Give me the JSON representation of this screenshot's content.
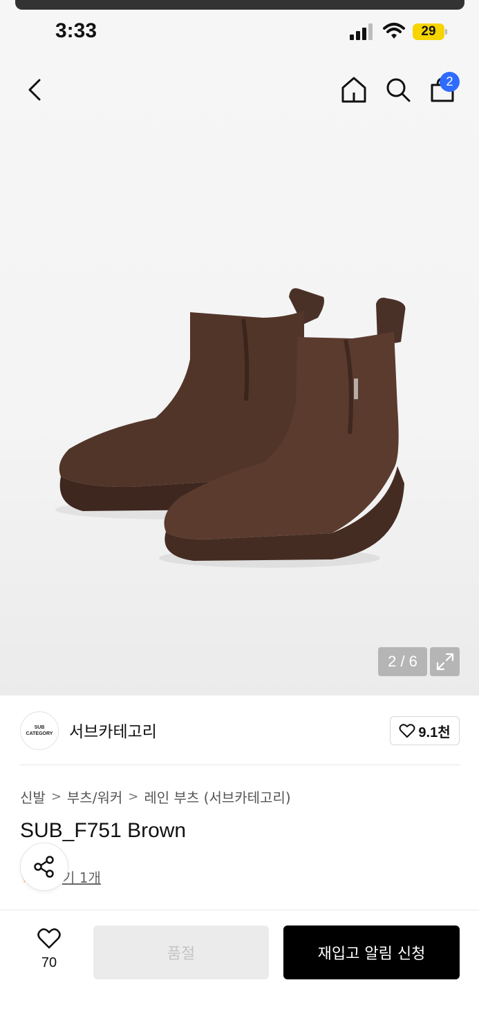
{
  "status_bar": {
    "time": "3:33",
    "battery": "29"
  },
  "header": {
    "back_icon": "chevron-left-icon",
    "home_icon": "home-icon",
    "search_icon": "search-icon",
    "bag_icon": "shopping-bag-icon",
    "bag_count": "2",
    "badge_color": "#2f6bff"
  },
  "gallery": {
    "counter": "2 / 6",
    "expand_icon": "expand-icon",
    "product_color": "#4a3128"
  },
  "brand": {
    "logo_line1": "SUB",
    "logo_line2": "CATEGORY",
    "name": "서브카테고리",
    "like_count": "9.1천"
  },
  "breadcrumb": {
    "items": [
      "신발",
      "부츠/워커",
      "레인 부츠 (서브카테고리)"
    ]
  },
  "product": {
    "title": "SUB_F751 Brown",
    "review_link": "후기 1개",
    "review_visible": "기 1개"
  },
  "bottom_bar": {
    "wish_count": "70",
    "soldout_label": "품절",
    "restock_label": "재입고 알림 신청"
  }
}
